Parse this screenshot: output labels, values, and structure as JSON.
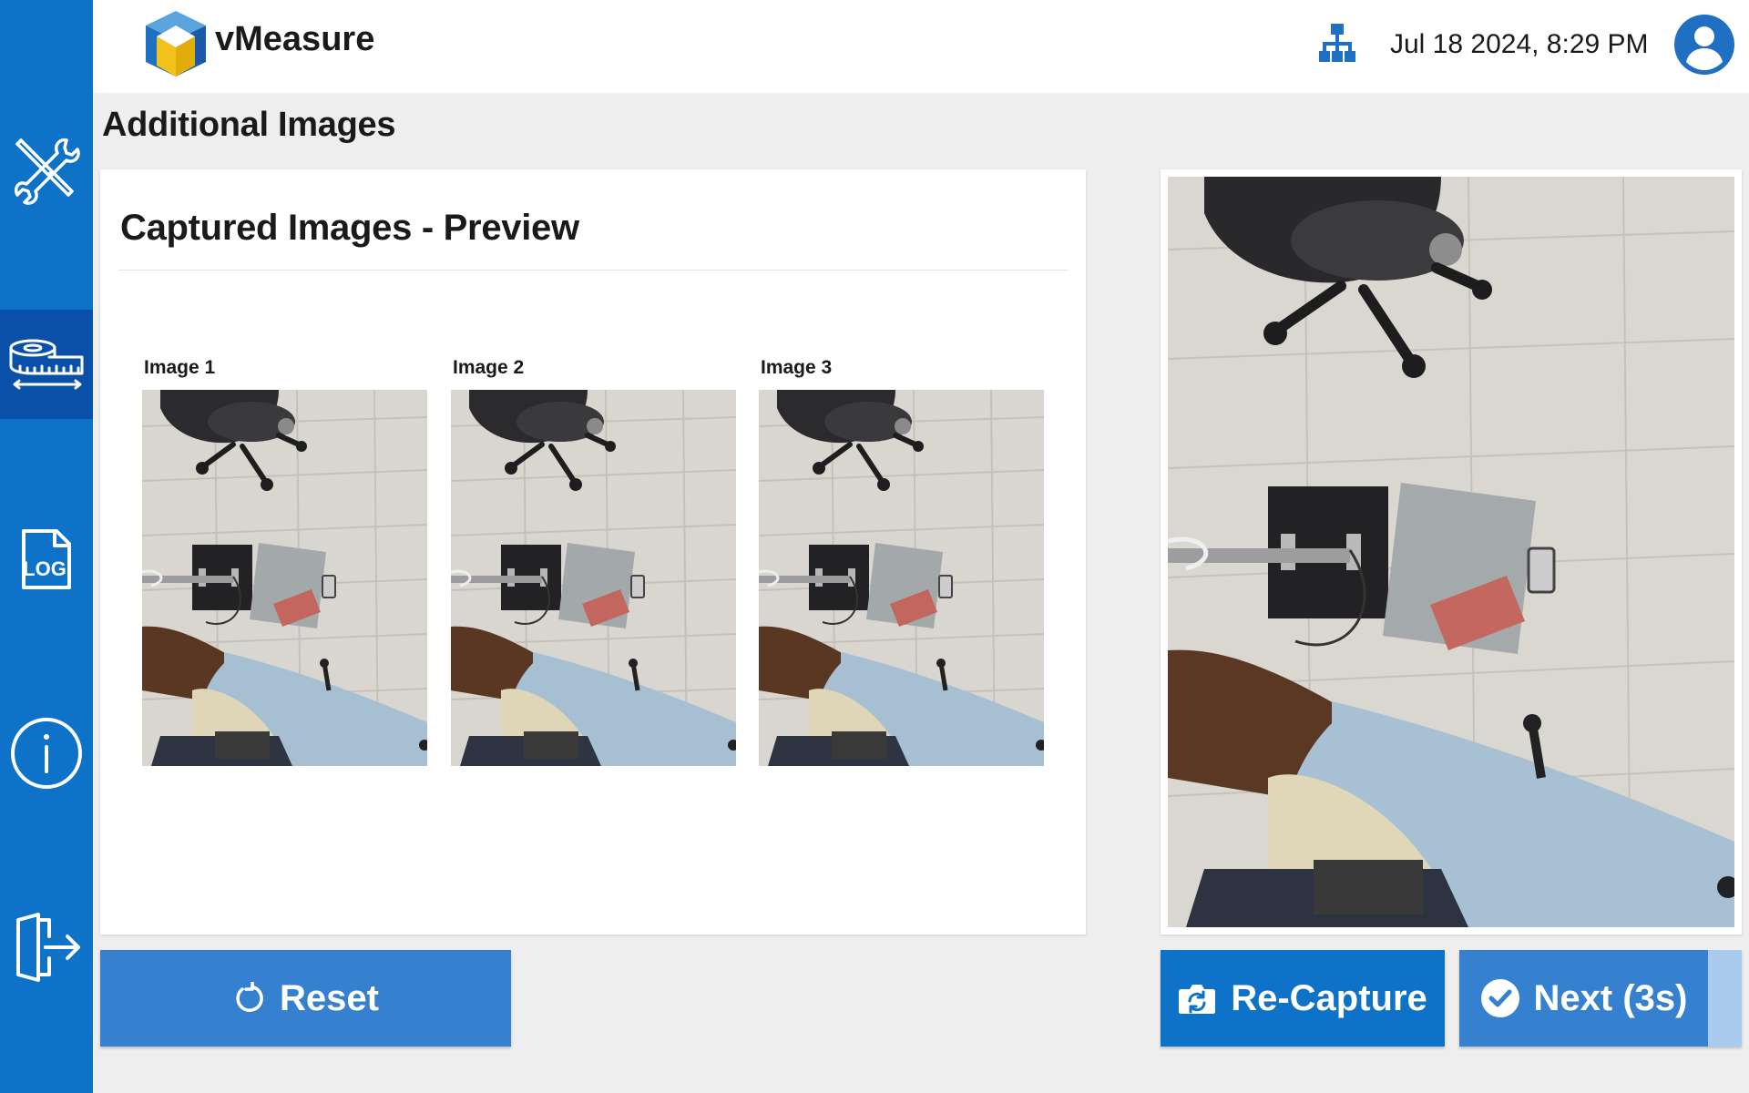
{
  "app": {
    "name": "vMeasure"
  },
  "header": {
    "datetime": "Jul 18 2024, 8:29 PM"
  },
  "sidebar": {
    "items": [
      {
        "icon": "tools-icon",
        "active": false
      },
      {
        "icon": "measuring-tape-icon",
        "active": true
      },
      {
        "icon": "log-file-icon",
        "label": "LOG",
        "active": false
      },
      {
        "icon": "info-icon",
        "active": false
      },
      {
        "icon": "logout-icon",
        "active": false
      }
    ]
  },
  "page": {
    "title": "Additional Images"
  },
  "preview": {
    "title": "Captured Images - Preview",
    "images": [
      {
        "label": "Image 1"
      },
      {
        "label": "Image 2"
      },
      {
        "label": "Image 3"
      }
    ]
  },
  "buttons": {
    "reset": "Reset",
    "recapture": "Re-Capture",
    "next": "Next (3s)",
    "next_progress_fraction": 0.12
  },
  "colors": {
    "sidebar": "#0d72c8",
    "sidebar_active": "#0a4fa8",
    "button_primary": "#3681cf",
    "button_recapture": "#0d72c8",
    "progress_fill": "#a9cbee"
  }
}
